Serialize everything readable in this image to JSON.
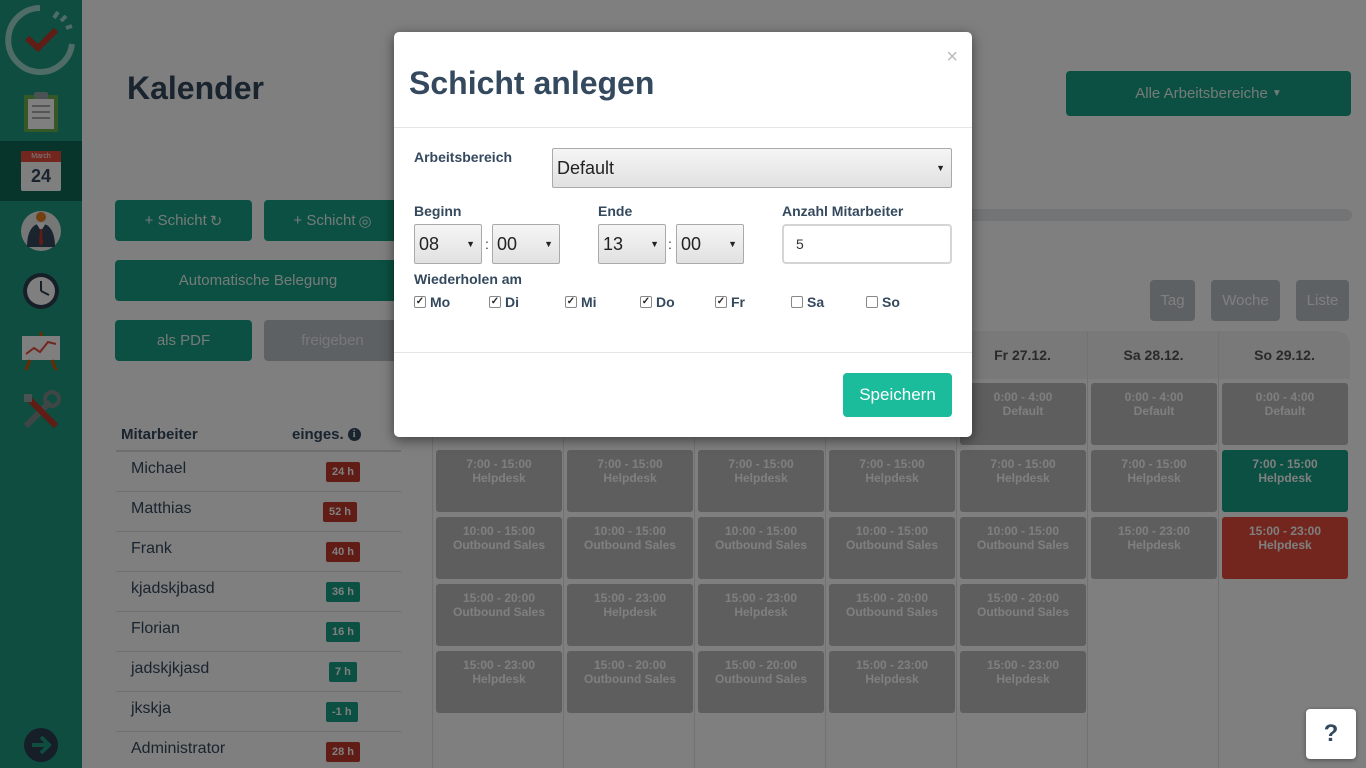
{
  "sidebar": {
    "calendar_month": "March",
    "calendar_day": "24"
  },
  "page": {
    "title": "Kalender",
    "area_dropdown": "Alle Arbeitsbereiche"
  },
  "toolbar": {
    "add_shift_repeat": "+ Schicht",
    "add_shift_single": "+ Schicht",
    "auto_assign": "Automatische Belegung",
    "as_pdf": "als PDF",
    "publish": "freigeben"
  },
  "views": {
    "day": "Tag",
    "week": "Woche",
    "list": "Liste"
  },
  "staff": {
    "header_name": "Mitarbeiter",
    "header_hours": "einges.",
    "rows": [
      {
        "name": "Michael",
        "hours": "24 h"
      },
      {
        "name": "Matthias",
        "hours": "52 h"
      },
      {
        "name": "Frank",
        "hours": "40 h"
      },
      {
        "name": "kjadskjbasd",
        "hours": "36 h"
      },
      {
        "name": "Florian",
        "hours": "16 h"
      },
      {
        "name": "jadskjkjasd",
        "hours": "7 h"
      },
      {
        "name": "jkskja",
        "hours": "-1 h"
      },
      {
        "name": "Administrator",
        "hours": "28 h"
      }
    ],
    "colors": {
      "over": "#c0392b",
      "ok": "#16a085"
    }
  },
  "calendar": {
    "days": [
      "",
      "",
      "",
      "",
      "Fr 27.12.",
      "Sa 28.12.",
      "So 29.12."
    ],
    "columns": [
      [
        {
          "time": "7:00 - 15:00",
          "area": "Helpdesk"
        },
        {
          "time": "10:00 - 15:00",
          "area": "Outbound Sales"
        },
        {
          "time": "15:00 - 20:00",
          "area": "Outbound Sales"
        },
        {
          "time": "15:00 - 23:00",
          "area": "Helpdesk"
        }
      ],
      [
        {
          "time": "7:00 - 15:00",
          "area": "Helpdesk"
        },
        {
          "time": "10:00 - 15:00",
          "area": "Outbound Sales"
        },
        {
          "time": "15:00 - 23:00",
          "area": "Helpdesk"
        },
        {
          "time": "15:00 - 20:00",
          "area": "Outbound Sales"
        }
      ],
      [
        {
          "time": "7:00 - 15:00",
          "area": "Helpdesk"
        },
        {
          "time": "10:00 - 15:00",
          "area": "Outbound Sales"
        },
        {
          "time": "15:00 - 23:00",
          "area": "Helpdesk"
        },
        {
          "time": "15:00 - 20:00",
          "area": "Outbound Sales"
        }
      ],
      [
        {
          "time": "7:00 - 15:00",
          "area": "Helpdesk"
        },
        {
          "time": "10:00 - 15:00",
          "area": "Outbound Sales"
        },
        {
          "time": "15:00 - 20:00",
          "area": "Outbound Sales"
        },
        {
          "time": "15:00 - 23:00",
          "area": "Helpdesk"
        }
      ],
      [
        {
          "time": "0:00 - 4:00",
          "area": "Default"
        },
        {
          "time": "7:00 - 15:00",
          "area": "Helpdesk"
        },
        {
          "time": "10:00 - 15:00",
          "area": "Outbound Sales"
        },
        {
          "time": "15:00 - 20:00",
          "area": "Outbound Sales"
        },
        {
          "time": "15:00 - 23:00",
          "area": "Helpdesk"
        }
      ],
      [
        {
          "time": "0:00 - 4:00",
          "area": "Default"
        },
        {
          "time": "7:00 - 15:00",
          "area": "Helpdesk"
        },
        {
          "time": "15:00 - 23:00",
          "area": "Helpdesk"
        }
      ],
      [
        {
          "time": "0:00 - 4:00",
          "area": "Default"
        },
        {
          "time": "7:00 - 15:00",
          "area": "Helpdesk",
          "status": "filled"
        },
        {
          "time": "15:00 - 23:00",
          "area": "Helpdesk",
          "status": "open"
        }
      ]
    ],
    "colors": {
      "default": "#bdbdbd",
      "filled": "#16a085",
      "open": "#e74c3c"
    }
  },
  "modal": {
    "title": "Schicht anlegen",
    "close": "×",
    "area_label": "Arbeitsbereich",
    "area_value": "Default",
    "start_label": "Beginn",
    "start_hour": "08",
    "start_min": "00",
    "end_label": "Ende",
    "end_hour": "13",
    "end_min": "00",
    "colon": ":",
    "count_label": "Anzahl Mitarbeiter",
    "count_value": "5",
    "repeat_label": "Wiederholen am",
    "days": [
      {
        "label": "Mo",
        "checked": true
      },
      {
        "label": "Di",
        "checked": true
      },
      {
        "label": "Mi",
        "checked": true
      },
      {
        "label": "Do",
        "checked": true
      },
      {
        "label": "Fr",
        "checked": true
      },
      {
        "label": "Sa",
        "checked": false
      },
      {
        "label": "So",
        "checked": false
      }
    ],
    "save": "Speichern"
  },
  "help": "?"
}
